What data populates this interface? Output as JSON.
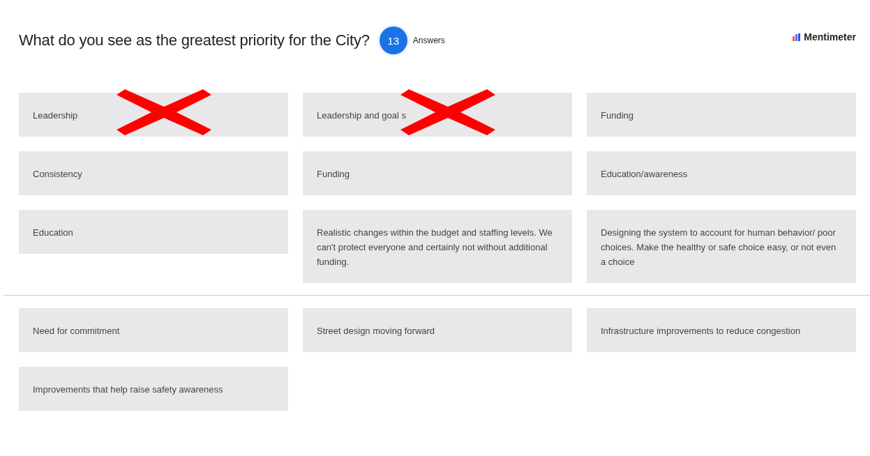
{
  "header": {
    "question": "What do you see as the greatest priority for the City?",
    "count": "13",
    "count_label": "Answers",
    "brand": "Mentimeter"
  },
  "sections": [
    {
      "answers": [
        {
          "text": "Leadership",
          "crossed": true
        },
        {
          "text": "Leadership and goal s",
          "crossed": true
        },
        {
          "text": "Funding",
          "crossed": false
        },
        {
          "text": "Consistency",
          "crossed": false
        },
        {
          "text": "Funding",
          "crossed": false
        },
        {
          "text": "Education/awareness",
          "crossed": false
        },
        {
          "text": "Education",
          "crossed": false
        },
        {
          "text": "Realistic changes within the budget and staffing levels. We can't protect everyone and certainly not without additional funding.",
          "crossed": false
        },
        {
          "text": "Designing the system to account for human behavior/ poor choices. Make the healthy or safe choice easy, or not even a choice",
          "crossed": false
        }
      ]
    },
    {
      "answers": [
        {
          "text": "Need for commitment",
          "crossed": false
        },
        {
          "text": "Street design moving forward",
          "crossed": false
        },
        {
          "text": "Infrastructure improvements to reduce congestion",
          "crossed": false
        },
        {
          "text": "Improvements that help raise safety awareness",
          "crossed": false
        }
      ]
    }
  ]
}
